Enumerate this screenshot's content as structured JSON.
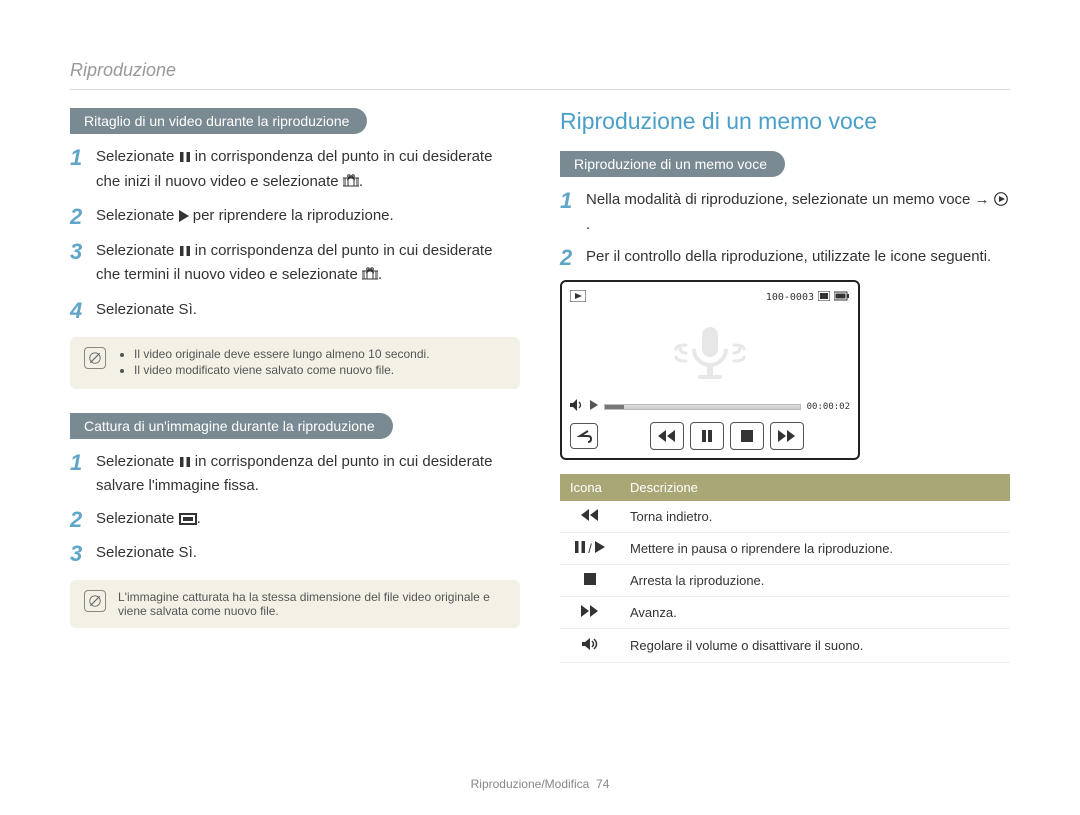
{
  "section_top": "Riproduzione",
  "left": {
    "pill1": "Ritaglio di un video durante la riproduzione",
    "s1a": "Selezionate ",
    "s1b": " in corrispondenza del punto in cui desiderate che inizi il nuovo video e selezionate ",
    "s2a": "Selezionate ",
    "s2b": " per riprendere la riproduzione.",
    "s3a": "Selezionate ",
    "s3b": " in corrispondenza del punto in cui desiderate che termini il nuovo video e selezionate ",
    "s4": "Selezionate Sì.",
    "note1_a": "Il video originale deve essere lungo almeno 10 secondi.",
    "note1_b": "Il video modificato viene salvato come nuovo file.",
    "pill2": "Cattura di un'immagine durante la riproduzione",
    "c1a": "Selezionate ",
    "c1b": " in corrispondenza del punto in cui desiderate salvare l'immagine fissa.",
    "c2": "Selezionate ",
    "c3": "Selezionate Sì.",
    "note2": "L'immagine catturata ha la stessa dimensione del file video originale e viene salvata come nuovo file."
  },
  "right": {
    "title": "Riproduzione di un memo voce",
    "pill": "Riproduzione di un memo voce",
    "r1a": "Nella modalità di riproduzione, selezionate un memo voce → ",
    "r2": "Per il controllo della riproduzione, utilizzate le icone seguenti.",
    "device_file": "100-0003",
    "device_time": "00:00:02",
    "table": {
      "h1": "Icona",
      "h2": "Descrizione",
      "d1": "Torna indietro.",
      "d2": "Mettere in pausa o riprendere la riproduzione.",
      "d3": "Arresta la riproduzione.",
      "d4": "Avanza.",
      "d5": "Regolare il volume o disattivare il suono."
    }
  },
  "footer_label": "Riproduzione/Modifica",
  "footer_page": "74"
}
